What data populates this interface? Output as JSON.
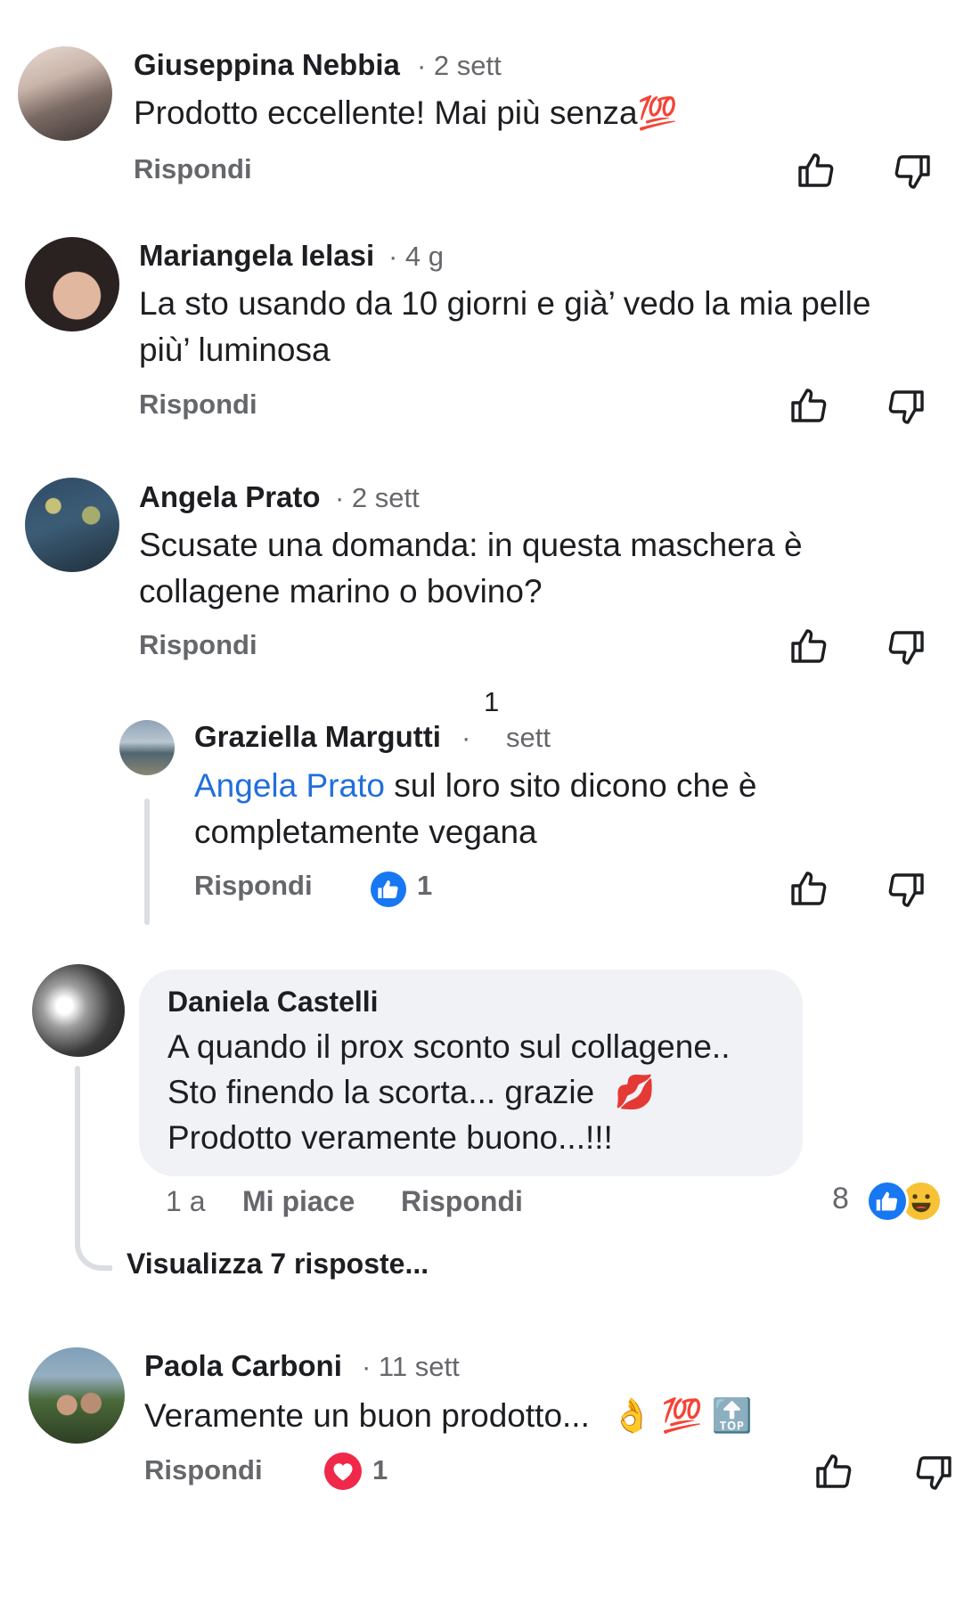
{
  "comments": [
    {
      "author": "Giuseppina Nebbia",
      "time": "· 2 sett",
      "text": "Prodotto eccellente! Mai più senza",
      "emoji": "💯",
      "reply": "Rispondi"
    },
    {
      "author": "Mariangela Ielasi",
      "time": "· 4 g",
      "text_line1": "La sto usando da 10 giorni e già’ vedo la mia pelle",
      "text_line2": "più’ luminosa",
      "reply": "Rispondi"
    },
    {
      "author": "Angela Prato",
      "time": "·  2 sett",
      "text_line1": "Scusate una domanda: in questa maschera  è",
      "text_line2": "collagene marino o bovino?",
      "reply": "Rispondi"
    },
    {
      "author": "Graziella Margutti",
      "time_prefix": "·",
      "time_num": "1",
      "time_unit": "sett",
      "mention": "Angela Prato",
      "text_line1_rest": " sul loro sito dicono che è",
      "text_line2": "completamente vegana",
      "reply": "Rispondi",
      "like_count": "1"
    },
    {
      "author": "Daniela Castelli",
      "text_line1": "A quando il prox sconto sul collagene..",
      "text_line2": "Sto finendo la scorta... grazie",
      "text_line2_emoji": "💋",
      "text_line3": "Prodotto veramente buono...!!!",
      "age": "1 a",
      "like": "Mi piace",
      "reply": "Rispondi",
      "reaction_count": "8",
      "view_replies": "Visualizza 7 risposte..."
    },
    {
      "author": "Paola Carboni",
      "time": "· 11 sett",
      "text": "Veramente un buon prodotto...",
      "emojis": "👌 💯 🔝",
      "reply": "Rispondi",
      "love_count": "1"
    }
  ],
  "colors": {
    "accent": "#1877f2",
    "love": "#f02849",
    "muted": "#65676b"
  },
  "icons": [
    "thumbs-up-icon",
    "thumbs-down-icon",
    "like-reaction-icon",
    "love-reaction-icon",
    "haha-reaction-icon"
  ]
}
